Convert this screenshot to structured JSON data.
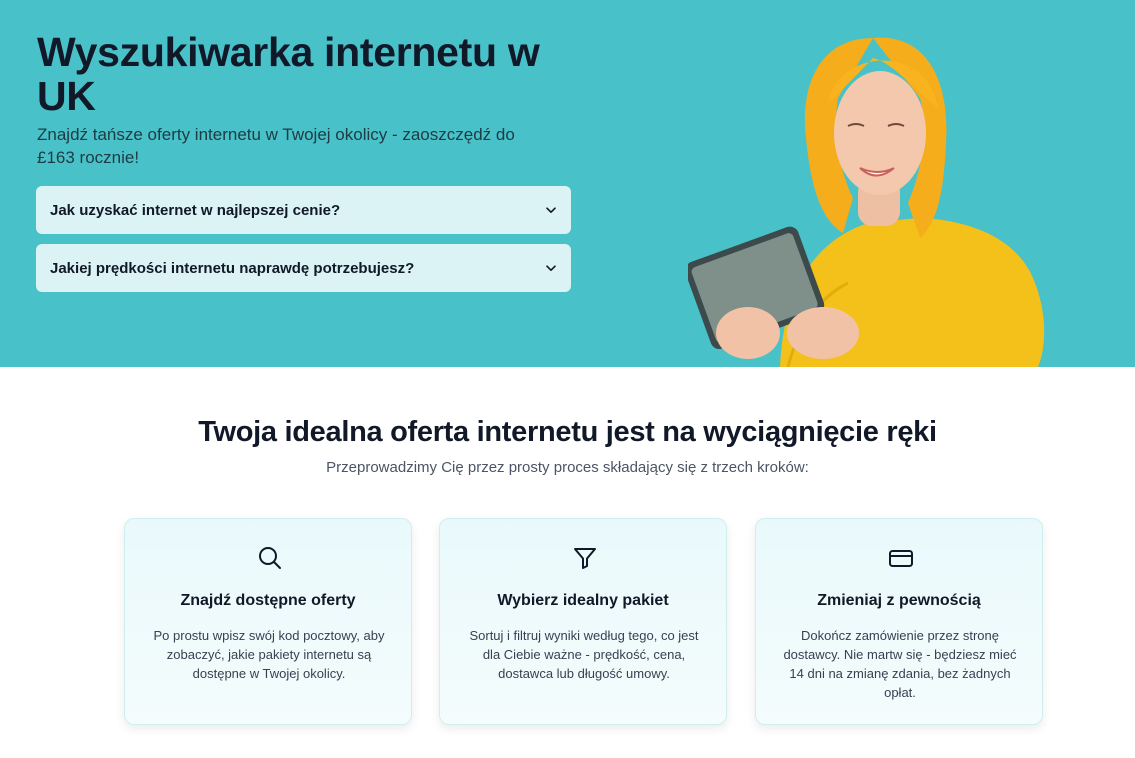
{
  "hero": {
    "title": "Wyszukiwarka internetu w UK",
    "subtitle": "Znajdź tańsze oferty internetu w Twojej okolicy - zaoszczędź do £163 rocznie!",
    "background_color": "#48c1c9",
    "accordions": [
      {
        "label": "Jak uzyskać internet w najlepszej cenie?",
        "icon": "chevron-down-icon"
      },
      {
        "label": "Jakiej prędkości internetu naprawdę potrzebujesz?",
        "icon": "chevron-down-icon"
      }
    ],
    "photo": "woman-with-tablet"
  },
  "steps_section": {
    "title": "Twoja idealna oferta internetu jest na wyciągnięcie ręki",
    "subtitle": "Przeprowadzimy Cię przez prosty proces składający się z trzech kroków:",
    "cards": [
      {
        "icon": "search-icon",
        "title": "Znajdź dostępne oferty",
        "text": "Po prostu wpisz swój kod pocztowy, aby zobaczyć, jakie pakiety internetu są dostępne w Twojej okolicy."
      },
      {
        "icon": "filter-icon",
        "title": "Wybierz idealny pakiet",
        "text": "Sortuj i filtruj wyniki według tego, co jest dla Ciebie ważne - prędkość, cena, dostawca lub długość umowy."
      },
      {
        "icon": "credit-card-icon",
        "title": "Zmieniaj z pewnością",
        "text": "Dokończ zamówienie przez stronę dostawcy. Nie martw się - będziesz mieć 14 dni na zmianę zdania, bez żadnych opłat."
      }
    ]
  }
}
